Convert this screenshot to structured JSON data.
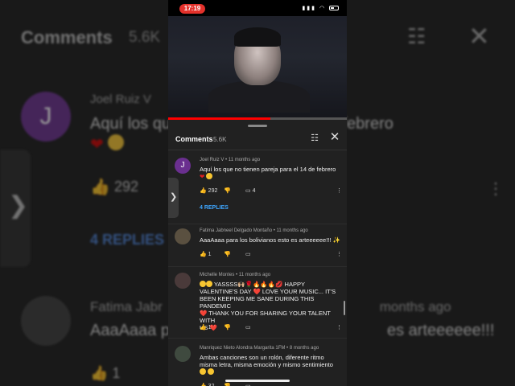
{
  "background": {
    "title": "Comments",
    "count": "5.6K",
    "author": "Joel Ruiz V",
    "text": "Aquí los qu",
    "text_tail": "a el 14 de febrero",
    "like_count": "292",
    "replies": "4 REPLIES",
    "author2_start": "Fatima Jabr",
    "author2_end": "months ago",
    "text2_start": "AaaAaaa p",
    "text2_end": "es arteeeeee!!!",
    "like_count2": "1",
    "avatar_letter": "J"
  },
  "status_bar": {
    "time": "17:19",
    "signal": "▮▮▮",
    "wifi": "◠"
  },
  "video": {
    "progress_fraction": 0.57
  },
  "sheet": {
    "title": "Comments",
    "count": "5.6K"
  },
  "comments": [
    {
      "author": "Joel Ruiz V",
      "time": "11 months ago",
      "avatar_letter": "J",
      "avatar_color": "#6a2f8f",
      "text": "Aquí los que no tienen pareja para el 14 de febrero",
      "likes": "292",
      "reply_count": "4",
      "replies_label": "4 REPLIES"
    },
    {
      "author": "Fatima Jabneel Delgado Montaño",
      "time": "11 months ago",
      "avatar_color": "#5a5040",
      "text": "AaaAaaa para los bolivianos esto es arteeeeee!!! ✨",
      "likes": "1"
    },
    {
      "author": "Michelle Montes",
      "time": "11 months ago",
      "avatar_color": "#4a3a3a",
      "text_lines": [
        "YASSSS🙌🏼🌹🔥🔥🔥💋 HAPPY",
        "VALENTINE'S DAY ❤️ LOVE YOUR MUSIC... IT'S",
        "BEEN KEEPING ME SANE DURING THIS PANDEMIC",
        "❤️ THANK YOU FOR SHARING YOUR TALENT WITH",
        "US ❤️"
      ],
      "likes": "1"
    },
    {
      "author": "Manriquez Nieto Alondra Margarita 1FM",
      "time": "8 months ago",
      "avatar_color": "#3f4a3f",
      "text_lines": [
        "Ambas canciones son un rolón, diferente ritmo",
        "misma letra, misma emoción y mismo sentimiento"
      ],
      "likes": "32"
    }
  ],
  "icons": {
    "like": "like-icon",
    "dislike": "dislike-icon",
    "reply": "reply-icon",
    "more": "more-vert-icon",
    "tune": "tune-icon",
    "close": "close-icon"
  },
  "colors": {
    "accent_blue": "#3ea6ff",
    "status_red": "#e4312b",
    "progress_red": "#ff0000",
    "heart_red": "#e02020"
  }
}
